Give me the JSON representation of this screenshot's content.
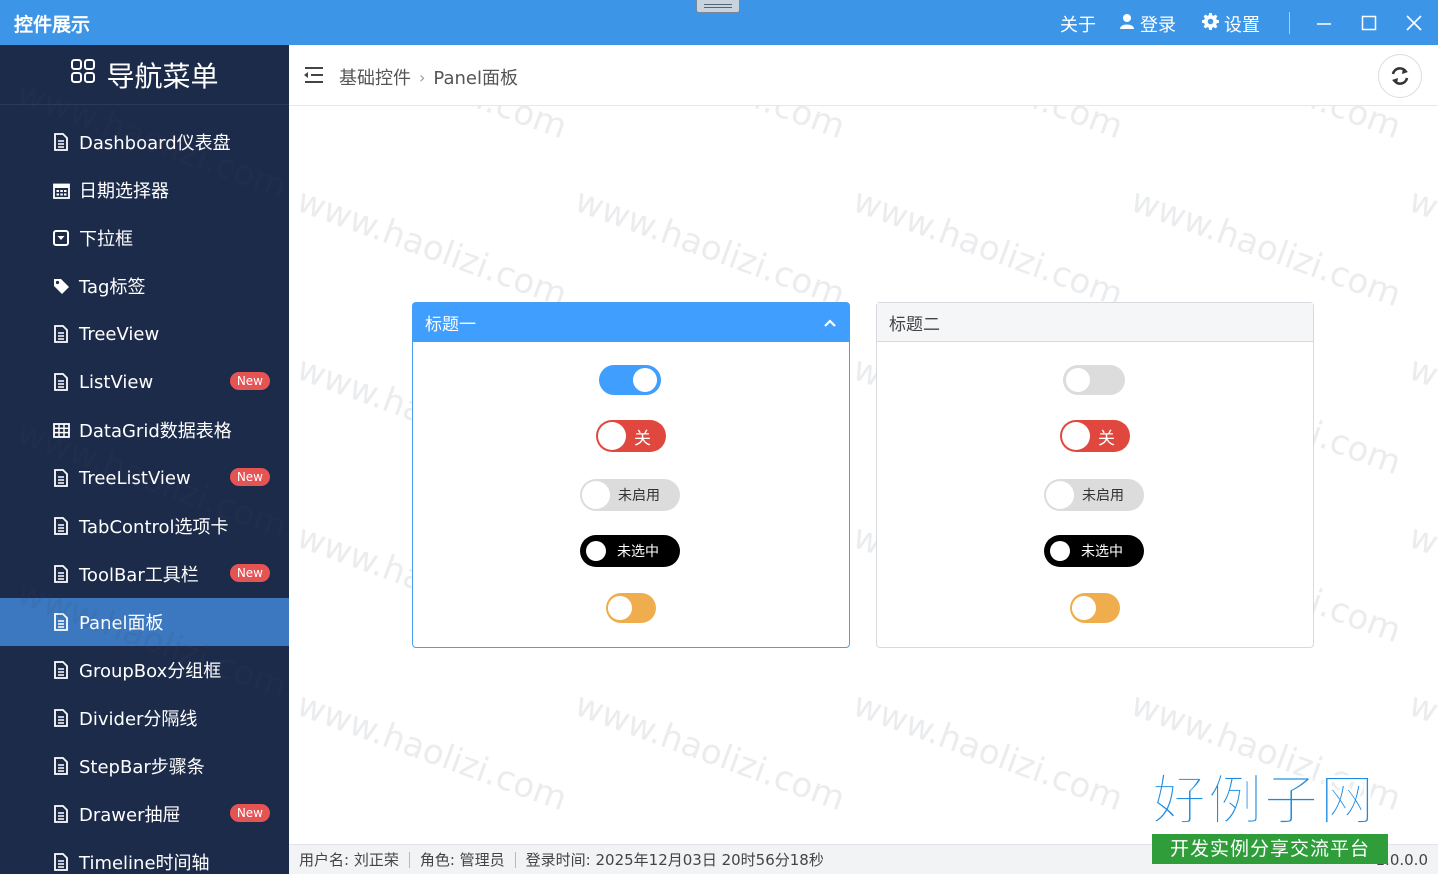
{
  "titlebar": {
    "app_title": "控件展示",
    "about": "关于",
    "login": "登录",
    "settings": "设置"
  },
  "sidebar": {
    "title": "导航菜单",
    "items": [
      {
        "label": "Dashboard仪表盘",
        "icon": "file-icon",
        "badge": ""
      },
      {
        "label": "日期选择器",
        "icon": "calendar-icon",
        "badge": ""
      },
      {
        "label": "下拉框",
        "icon": "dropdown-icon",
        "badge": ""
      },
      {
        "label": "Tag标签",
        "icon": "tag-icon",
        "badge": ""
      },
      {
        "label": "TreeView",
        "icon": "file-icon",
        "badge": ""
      },
      {
        "label": "ListView",
        "icon": "file-icon",
        "badge": "New"
      },
      {
        "label": "DataGrid数据表格",
        "icon": "grid-icon",
        "badge": ""
      },
      {
        "label": "TreeListView",
        "icon": "file-icon",
        "badge": "New"
      },
      {
        "label": "TabControl选项卡",
        "icon": "file-icon",
        "badge": ""
      },
      {
        "label": "ToolBar工具栏",
        "icon": "file-icon",
        "badge": "New"
      },
      {
        "label": "Panel面板",
        "icon": "file-icon",
        "badge": "",
        "active": true
      },
      {
        "label": "GroupBox分组框",
        "icon": "file-icon",
        "badge": ""
      },
      {
        "label": "Divider分隔线",
        "icon": "file-icon",
        "badge": ""
      },
      {
        "label": "StepBar步骤条",
        "icon": "file-icon",
        "badge": ""
      },
      {
        "label": "Drawer抽屉",
        "icon": "file-icon",
        "badge": "New"
      },
      {
        "label": "Timeline时间轴",
        "icon": "file-icon",
        "badge": ""
      }
    ]
  },
  "breadcrumb": {
    "parent": "基础控件",
    "current": "Panel面板"
  },
  "panels": [
    {
      "title": "标题一",
      "style": "primary",
      "switches": {
        "off_label": "关",
        "disabled_label": "未启用",
        "unchecked_label": "未选中"
      }
    },
    {
      "title": "标题二",
      "style": "default",
      "switches": {
        "off_label": "关",
        "disabled_label": "未启用",
        "unchecked_label": "未选中"
      }
    }
  ],
  "footer": {
    "username": "用户名: 刘正荣",
    "role": "角色: 管理员",
    "login_time": "登录时间: 2025年12月03日 20时56分18秒",
    "version": "1.0.0.0"
  },
  "watermark": "www.haolizi.com",
  "logo": {
    "main": "好例子网",
    "sub": "开发实例分享交流平台"
  },
  "colors": {
    "titlebar": "#3d95e8",
    "sidebar": "#1d2b4a",
    "active_item": "#3b78c0",
    "badge": "#e55353",
    "switch_on": "#409eff",
    "switch_red": "#e0483f",
    "switch_orange": "#f0ad4e"
  }
}
